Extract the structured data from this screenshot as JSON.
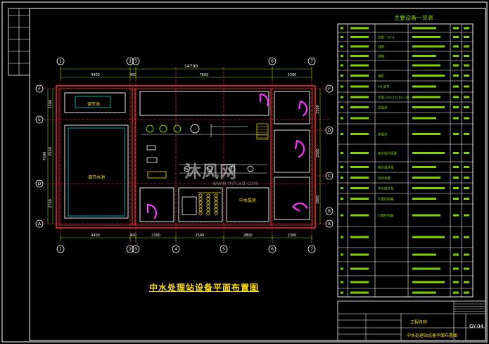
{
  "drawing": {
    "title": "中水处理站设备平面布置图",
    "total_dim": "14700",
    "top_dims": [
      "4400",
      "400",
      "7600",
      "2300"
    ],
    "bottom_dims": [
      "4400",
      "400",
      "2300",
      "2500",
      "2800",
      "2300"
    ],
    "left_dims": [
      "1500",
      "2500",
      "2700"
    ],
    "left_total": "7500",
    "right_dims": [
      "1500",
      "2500",
      "1900"
    ],
    "grid_top": [
      "1",
      "2",
      "3",
      "6",
      "7"
    ],
    "grid_bottom": [
      "1",
      "2",
      "3",
      "4",
      "5",
      "6",
      "7"
    ],
    "grid_left": [
      "F",
      "E",
      "D",
      "A"
    ],
    "grid_right": [
      "F",
      "D",
      "C",
      "B",
      "A"
    ],
    "room_labels": [
      "调节池",
      "调节水池",
      "中水泵房"
    ]
  },
  "equipment_table": {
    "title": "主要设备一览表",
    "row_texts": [
      "流量：3m3",
      "材质",
      "规格",
      "电机",
      "PH 调节",
      "流量 10m3/h 10~30",
      "混凝剂",
      "絮凝剂",
      "紫外线消毒器",
      "紫外线消毒",
      "加药装置",
      "中水提升泵",
      "计量控制箱",
      "计量控制器"
    ]
  },
  "title_block": {
    "drawing_no": "GY-04",
    "project": "工程名称",
    "sheet_title": "中水处理站设备平面布置图"
  },
  "watermark": {
    "text": "沐风网",
    "url": "www.mfcad.com"
  },
  "colors": {
    "background": "#000000",
    "frame": "#ffffff",
    "structure": "#ff2a2a",
    "axis": "#ff3b3b",
    "equipment": "#ffffff",
    "magenta": "#ff33ff",
    "table": "#7fd400",
    "cyan": "#00d0d0",
    "yellow": "#ffe000"
  }
}
